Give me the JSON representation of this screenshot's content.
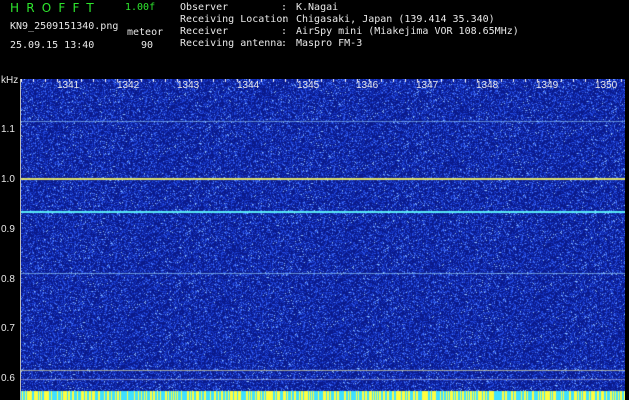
{
  "header": {
    "app_title": "HROFFT",
    "version": "1.00f",
    "filename": "KN9_2509151340.png",
    "datetime": "25.09.15 13:40",
    "meteor_label": "meteor",
    "meteor_count": "90"
  },
  "info": [
    {
      "key": "Observer",
      "value": "K.Nagai"
    },
    {
      "key": "Receiving Location",
      "value": "Chigasaki, Japan (139.414 35.340)"
    },
    {
      "key": "Receiver",
      "value": "AirSpy mini (Miakejima VOR 108.65MHz)"
    },
    {
      "key": "Receiving antenna",
      "value": "Maspro FM-3"
    }
  ],
  "spectrogram": {
    "y_unit": "kHz",
    "y_ticks": [
      "1.1",
      "1.0",
      "0.9",
      "0.8",
      "0.7",
      "0.6"
    ],
    "x_ticks": [
      "1341",
      "1342",
      "1343",
      "1344",
      "1345",
      "1346",
      "1347",
      "1348",
      "1349",
      "1350"
    ],
    "colors": {
      "background": "#0a1a8c",
      "noise": "#3a5cff",
      "strong_line": "#ffff60",
      "carrier": "#60ffff"
    }
  }
}
